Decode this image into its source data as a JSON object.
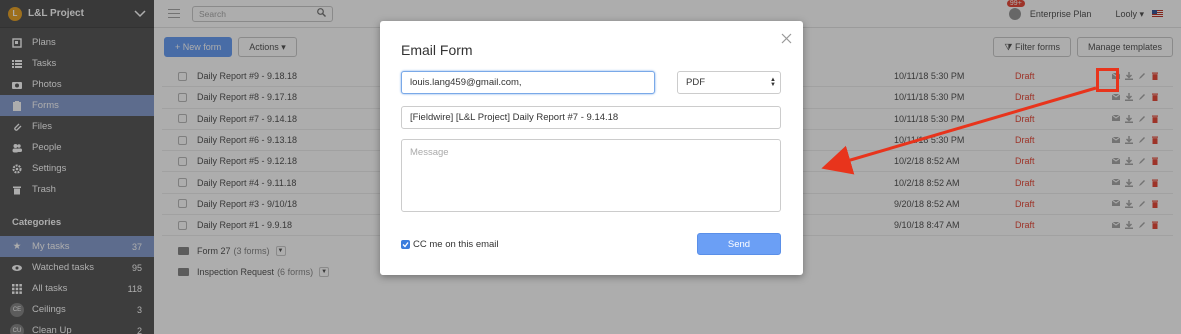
{
  "sidebar": {
    "project_initial": "L",
    "project_name": "L&L Project",
    "nav": [
      {
        "label": "Plans",
        "icon": "plans-icon"
      },
      {
        "label": "Tasks",
        "icon": "tasks-icon"
      },
      {
        "label": "Photos",
        "icon": "camera-icon"
      },
      {
        "label": "Forms",
        "icon": "clipboard-icon",
        "active": true
      },
      {
        "label": "Files",
        "icon": "paperclip-icon"
      },
      {
        "label": "People",
        "icon": "people-icon"
      },
      {
        "label": "Settings",
        "icon": "gear-icon"
      },
      {
        "label": "Trash",
        "icon": "trash-icon"
      }
    ],
    "categories_title": "Categories",
    "categories": [
      {
        "label": "My tasks",
        "count": "37",
        "icon": "star-icon"
      },
      {
        "label": "Watched tasks",
        "count": "95",
        "icon": "eye-icon"
      },
      {
        "label": "All tasks",
        "count": "118",
        "icon": "grid-icon"
      },
      {
        "label": "Ceilings",
        "count": "3",
        "badge": "CE"
      },
      {
        "label": "Clean Up",
        "count": "2",
        "badge": "CU"
      }
    ]
  },
  "topbar": {
    "search_placeholder": "Search",
    "notification_badge": "99+",
    "plan": "Enterprise Plan",
    "user": "Looly"
  },
  "toolbar": {
    "new_form": "New form",
    "actions": "Actions",
    "filter": "Filter forms",
    "manage": "Manage templates"
  },
  "forms": [
    {
      "name": "Daily Report #9 - 9.18.18",
      "date": "10/11/18 5:30 PM",
      "status": "Draft"
    },
    {
      "name": "Daily Report #8 - 9.17.18",
      "date": "10/11/18 5:30 PM",
      "status": "Draft"
    },
    {
      "name": "Daily Report #7 - 9.14.18",
      "date": "10/11/18 5:30 PM",
      "status": "Draft"
    },
    {
      "name": "Daily Report #6 - 9.13.18",
      "date": "10/11/18 5:30 PM",
      "status": "Draft"
    },
    {
      "name": "Daily Report #5 - 9.12.18",
      "date": "10/2/18 8:52 AM",
      "status": "Draft"
    },
    {
      "name": "Daily Report #4 - 9.11.18",
      "date": "10/2/18 8:52 AM",
      "status": "Draft"
    },
    {
      "name": "Daily Report #3 - 9/10/18",
      "date": "9/20/18 8:52 AM",
      "status": "Draft"
    },
    {
      "name": "Daily Report #1 - 9.9.18",
      "date": "9/10/18 8:47 AM",
      "status": "Draft"
    }
  ],
  "folders": [
    {
      "name": "Form 27",
      "count": "(3 forms)"
    },
    {
      "name": "Inspection Request",
      "count": "(6 forms)"
    }
  ],
  "modal": {
    "title": "Email Form",
    "to_value": "louis.lang459@gmail.com,",
    "format_value": "PDF",
    "subject_value": "[Fieldwire] [L&L Project] Daily Report #7 - 9.14.18",
    "message_placeholder": "Message",
    "cc_label": "CC me on this email",
    "send_label": "Send"
  },
  "colors": {
    "accent": "#6b9ff5",
    "draft": "#e74c3c",
    "annotation": "#e8341c"
  }
}
